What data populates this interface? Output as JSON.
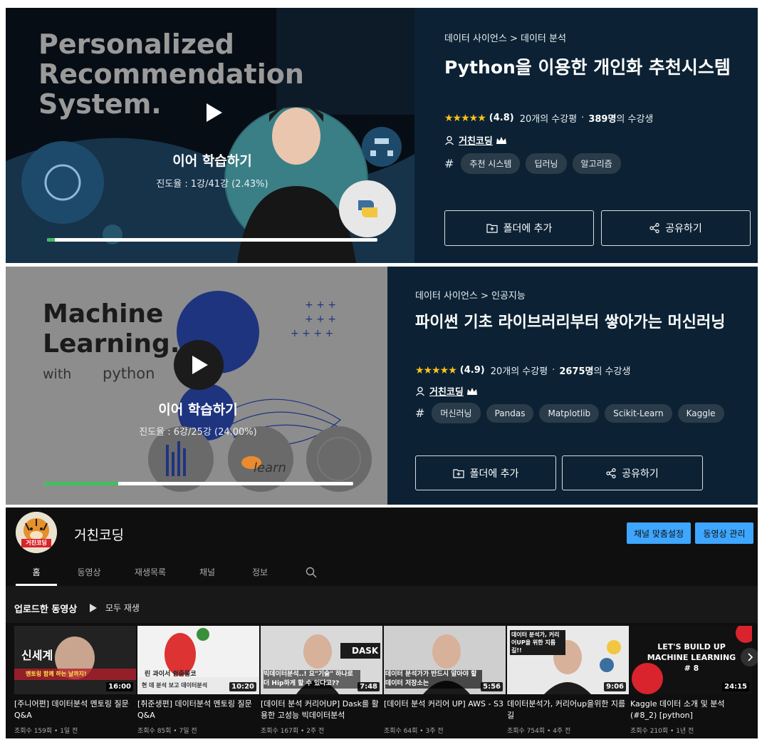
{
  "course1": {
    "thumb_text": "Personalized Recommendation System.",
    "continue": "이어 학습하기",
    "progress_text": "진도율 : 1강/41강 (2.43%)",
    "progress": 0.0243,
    "breadcrumb": "데이터 사이언스 > 데이터 분석",
    "title": "Python을 이용한 개인화 추천시스템",
    "stars": "★★★★★",
    "score": "(4.8)",
    "reviews": "20개의 수강평",
    "students": "389명",
    "students_suffix": "의 수강생",
    "author": "거친코딩",
    "tags": [
      "추천 시스템",
      "딥러닝",
      "알고리즘"
    ],
    "folder_btn": "폴더에 추가",
    "share_btn": "공유하기"
  },
  "course2": {
    "thumb_line1": "Machine",
    "thumb_line2": "Learning.",
    "thumb_line3": "with",
    "thumb_line4": "python",
    "thumb_badge": "learn",
    "continue": "이어 학습하기",
    "progress_text": "진도율 : 6강/25강 (24.00%)",
    "progress": 0.24,
    "breadcrumb": "데이터 사이언스 > 인공지능",
    "title": "파이썬 기초 라이브러리부터 쌓아가는 머신러닝",
    "stars": "★★★★★",
    "score": "(4.9)",
    "reviews": "20개의 수강평",
    "students": "2675명",
    "students_suffix": "의 수강생",
    "author": "거친코딩",
    "tags": [
      "머신러닝",
      "Pandas",
      "Matplotlib",
      "Scikit-Learn",
      "Kaggle"
    ],
    "folder_btn": "폴더에 추가",
    "share_btn": "공유하기"
  },
  "youtube": {
    "avatar_text": "거친코딩",
    "channel_name": "거친코딩",
    "customize_btn": "채널 맞춤설정",
    "manage_btn": "동영상 관리",
    "tabs": [
      "홈",
      "동영상",
      "재생목록",
      "채널",
      "정보"
    ],
    "uploads_label": "업로드한 동영상",
    "play_all": "모두 재생",
    "videos": [
      {
        "title": "[주니어편] 데이터분석 멘토링 질문 Q&A",
        "duration": "16:00",
        "meta": "조회수 159회 • 1일 전",
        "thumb_text": "신세계",
        "thumb_sub": "멘토링 함께 하는 날까지!"
      },
      {
        "title": "[취준생편] 데이터분석 멘토링 질문 Q&A",
        "duration": "10:20",
        "meta": "조회수 85회 • 7일 전",
        "thumb_text": "린 과이서 쉽줌물코",
        "thumb_sub": "현 데 분석 보고 데이터분석"
      },
      {
        "title": "[데이터 분석 커리어UP] Dask를 활용한 고성능 빅데이터분석",
        "duration": "7:48",
        "meta": "조회수 167회 • 2주 전",
        "thumb_text": "DASK",
        "thumb_sub": "빅데이터분석..! 요\"기술\" 하나로 더 Hip하게 할 수 있다고??"
      },
      {
        "title": "[데이터 분석 커리어 UP] AWS - S3",
        "duration": "5:56",
        "meta": "조회수 64회 • 3주 전",
        "thumb_text": "",
        "thumb_sub": "데이터 분석가가 반드시 알아야 할 데이터 저장소는"
      },
      {
        "title": "데이터분석가, 커리어up을위한 지름길",
        "duration": "9:06",
        "meta": "조회수 754회 • 4주 전",
        "thumb_text": "데이터 분석가, 커리어UP을 위한 지름길!!",
        "thumb_sub": ""
      },
      {
        "title": "Kaggle 데이터 소개 및 분석 (#8_2) [python]",
        "duration": "24:15",
        "meta": "조회수 210회 • 1년 전",
        "thumb_text": "LET'S BUILD UP MACHINE LEARNING # 8",
        "thumb_sub": ""
      }
    ]
  }
}
